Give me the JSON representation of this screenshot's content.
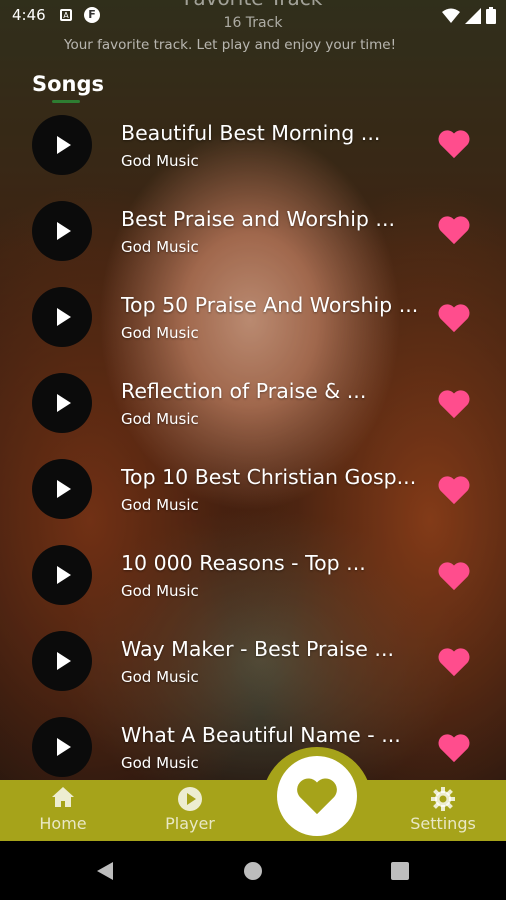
{
  "status_bar": {
    "time": "4:46"
  },
  "header": {
    "title": "Favorite Track",
    "count": "16 Track",
    "subtitle": "Your favorite track. Let play and enjoy your time!"
  },
  "songs_label": "Songs",
  "songs": [
    {
      "title": "Beautiful Best Morning ...",
      "artist": "God Music"
    },
    {
      "title": "Best Praise and Worship ...",
      "artist": "God Music"
    },
    {
      "title": "Top 50 Praise And Worship ...",
      "artist": "God Music"
    },
    {
      "title": "Reflection of Praise & ...",
      "artist": "God Music"
    },
    {
      "title": "Top 10 Best Christian Gosp...",
      "artist": "God Music"
    },
    {
      "title": "10 000 Reasons - Top ...",
      "artist": "God Music"
    },
    {
      "title": "Way Maker - Best Praise ...",
      "artist": "God Music"
    },
    {
      "title": "What A Beautiful Name - ...",
      "artist": "God Music"
    }
  ],
  "bottom_nav": {
    "home": "Home",
    "player": "Player",
    "settings": "Settings"
  },
  "colors": {
    "accent": "#a6a31a",
    "heart": "#ff4d8d",
    "play_button": "#0b0b0b"
  },
  "icons": {
    "play": "play-icon",
    "favorite": "heart-icon",
    "home": "home-icon",
    "player": "play-circle-icon",
    "settings": "gear-icon"
  }
}
